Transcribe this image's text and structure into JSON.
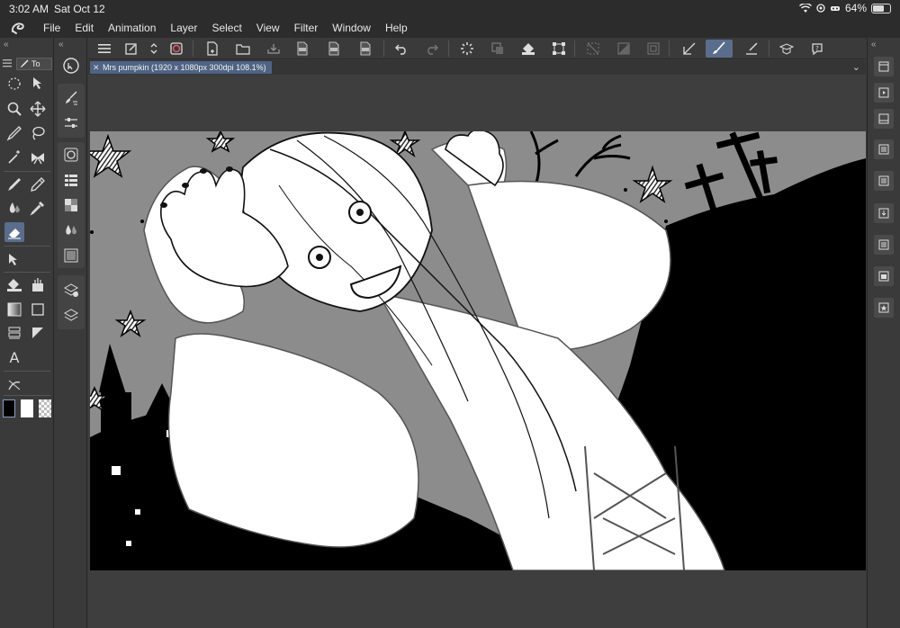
{
  "status_bar": {
    "time": "3:02 AM",
    "date": "Sat Oct 12",
    "battery": "64%",
    "battery_level": 0.64
  },
  "menu": {
    "items": [
      "File",
      "Edit",
      "Animation",
      "Layer",
      "Select",
      "View",
      "Filter",
      "Window",
      "Help"
    ]
  },
  "tool_panel": {
    "tab_label": "To"
  },
  "document": {
    "tab_title": "Mrs pumpkin (1920 x 1080px 300dpi 108.1%)"
  },
  "icons": {
    "app_logo": "clip-studio-logo-icon",
    "wifi": "wifi-icon",
    "battery": "battery-icon",
    "undo": "undo-icon",
    "redo": "redo-icon",
    "close_tab": "close-icon"
  },
  "colors": {
    "accent": "#5a6d8c",
    "tab_active": "#4f6385",
    "panel": "#3a3a3a",
    "main_color": "#000000",
    "sub_color": "#ffffff"
  }
}
